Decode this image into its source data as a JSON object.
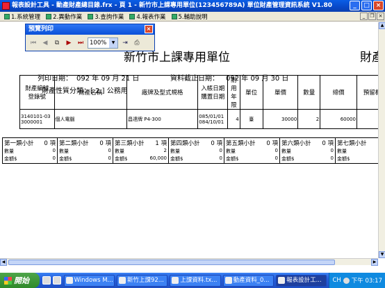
{
  "window": {
    "title": "報表設計工具 - 動產財產總目錄.frx - 頁 1 - 新竹市上課專用單位(123456789A)  單位財產管理資訊系統  V1.80",
    "min": "_",
    "max": "□",
    "close": "×"
  },
  "menu": [
    {
      "label": "1.系統管理"
    },
    {
      "label": "2.異動作業"
    },
    {
      "label": "3.查詢作業"
    },
    {
      "label": "4.報表作業"
    },
    {
      "label": "5.輔助說明"
    }
  ],
  "preview": {
    "title": "預覽列印",
    "zoom": "100%",
    "close": "×"
  },
  "report": {
    "title": "新竹市上課專用單位",
    "title2": "財產",
    "print_date_label": "列印日期：",
    "print_date": "092 年 09 月 21 日",
    "as_of_label": "資料截止日期：",
    "as_of": "092 年  09  月  30 日",
    "category_label": "財產性質分類：[ 2 ] 公務用",
    "headers": [
      "財產編號\n登錄號",
      "財產名稱",
      "廠牌及型式規格",
      "入帳日期\n購置日期",
      "耐用\n年限",
      "單位",
      "單價",
      "數量",
      "總價",
      "預留欄"
    ],
    "rows": [
      {
        "id": "3140101-03\n3000001",
        "name": "個人電腦",
        "brand": "昌達牌 P4-300",
        "date": "085/01/01\n084/10/01",
        "life": "4",
        "unit": "臺",
        "price": "30000",
        "qty": "2",
        "total": "60000",
        "reserved": ""
      }
    ],
    "subtotals": [
      {
        "label": "第一類小計",
        "count": "0",
        "unit": "項",
        "qty_label": "數量",
        "qty": "0",
        "amt_label": "金額$",
        "amt": "0"
      },
      {
        "label": "第二類小計",
        "count": "0",
        "unit": "項",
        "qty_label": "數量",
        "qty": "0",
        "amt_label": "金額$",
        "amt": "0"
      },
      {
        "label": "第三類小計",
        "count": "1",
        "unit": "項",
        "qty_label": "數量",
        "qty": "2",
        "amt_label": "金額$",
        "amt": "60,000"
      },
      {
        "label": "第四類小計",
        "count": "0",
        "unit": "項",
        "qty_label": "數量",
        "qty": "0",
        "amt_label": "金額$",
        "amt": "0"
      },
      {
        "label": "第五類小計",
        "count": "0",
        "unit": "項",
        "qty_label": "數量",
        "qty": "0",
        "amt_label": "金額$",
        "amt": "0"
      },
      {
        "label": "第六類小計",
        "count": "0",
        "unit": "項",
        "qty_label": "數量",
        "qty": "0",
        "amt_label": "金額$",
        "amt": "0"
      },
      {
        "label": "第七類小計",
        "count": "",
        "unit": "",
        "qty_label": "數量",
        "qty": "",
        "amt_label": "金額$",
        "amt": ""
      }
    ]
  },
  "taskbar": {
    "start": "開始",
    "tasks": [
      "Windows M...",
      "新竹上課92...",
      "上課資料.tx...",
      "動產資料_0...",
      "報表設計工..."
    ],
    "lang": "CH",
    "clock": "下午 03:17"
  }
}
